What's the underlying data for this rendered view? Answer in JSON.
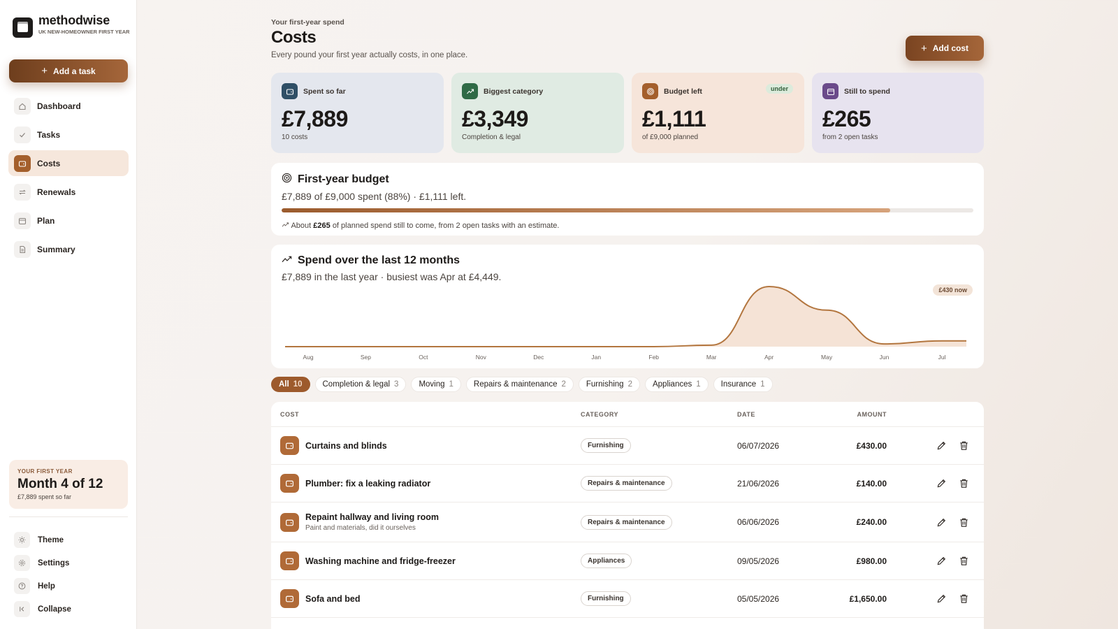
{
  "brand": {
    "name": "methodwise",
    "subtitle": "UK NEW-HOMEOWNER FIRST YEAR"
  },
  "sidebar": {
    "add_task_label": "Add a task",
    "items": [
      {
        "label": "Dashboard",
        "icon": "home-icon"
      },
      {
        "label": "Tasks",
        "icon": "check-icon"
      },
      {
        "label": "Costs",
        "icon": "wallet-icon",
        "active": true
      },
      {
        "label": "Renewals",
        "icon": "repeat-icon"
      },
      {
        "label": "Plan",
        "icon": "calendar-icon"
      },
      {
        "label": "Summary",
        "icon": "document-icon"
      }
    ],
    "year_card": {
      "label": "YOUR FIRST YEAR",
      "title": "Month 4 of 12",
      "subtitle": "£7,889 spent so far"
    },
    "footer": [
      {
        "label": "Theme",
        "icon": "sun-icon"
      },
      {
        "label": "Settings",
        "icon": "gear-icon"
      },
      {
        "label": "Help",
        "icon": "help-icon"
      },
      {
        "label": "Collapse",
        "icon": "collapse-icon"
      }
    ]
  },
  "header": {
    "eyebrow": "Your first-year spend",
    "title": "Costs",
    "description": "Every pound your first year actually costs, in one place.",
    "add_cost_label": "Add cost"
  },
  "stats": [
    {
      "label": "Spent so far",
      "value": "£7,889",
      "sub": "10 costs",
      "color": "#2f4f66"
    },
    {
      "label": "Biggest category",
      "value": "£3,349",
      "sub": "Completion & legal",
      "color": "#2f6a46"
    },
    {
      "label": "Budget left",
      "value": "£1,111",
      "sub": "of £9,000 planned",
      "color": "#a45f2c",
      "badge": "under"
    },
    {
      "label": "Still to spend",
      "value": "£265",
      "sub": "from 2 open tasks",
      "color": "#6a4a8a"
    }
  ],
  "budget": {
    "title": "First-year budget",
    "summary": "£7,889 of £9,000 spent (88%) · £1,111 left.",
    "progress_percent": 88,
    "note_prefix": "About",
    "note_amount": "£265",
    "note_suffix": "of planned spend still to come, from 2 open tasks with an estimate."
  },
  "spend": {
    "title": "Spend over the last 12 months",
    "summary": "£7,889 in the last year · busiest was Apr at £4,449.",
    "now_badge": "£430 now"
  },
  "chart_data": {
    "type": "area",
    "categories": [
      "Aug",
      "Sep",
      "Oct",
      "Nov",
      "Dec",
      "Jan",
      "Feb",
      "Mar",
      "Apr",
      "May",
      "Jun",
      "Jul"
    ],
    "values": [
      0,
      0,
      0,
      0,
      0,
      0,
      0,
      110,
      4449,
      2700,
      200,
      430
    ],
    "grid": false
  },
  "filters": [
    {
      "label": "All",
      "count": "10",
      "active": true
    },
    {
      "label": "Completion & legal",
      "count": "3"
    },
    {
      "label": "Moving",
      "count": "1"
    },
    {
      "label": "Repairs & maintenance",
      "count": "2"
    },
    {
      "label": "Furnishing",
      "count": "2"
    },
    {
      "label": "Appliances",
      "count": "1"
    },
    {
      "label": "Insurance",
      "count": "1"
    }
  ],
  "table": {
    "headers": {
      "cost": "COST",
      "category": "CATEGORY",
      "date": "DATE",
      "amount": "AMOUNT"
    },
    "rows": [
      {
        "name": "Curtains and blinds",
        "note": "",
        "category": "Furnishing",
        "date": "06/07/2026",
        "amount": "£430.00"
      },
      {
        "name": "Plumber: fix a leaking radiator",
        "note": "",
        "category": "Repairs & maintenance",
        "date": "21/06/2026",
        "amount": "£140.00"
      },
      {
        "name": "Repaint hallway and living room",
        "note": "Paint and materials, did it ourselves",
        "category": "Repairs & maintenance",
        "date": "06/06/2026",
        "amount": "£240.00"
      },
      {
        "name": "Washing machine and fridge-freezer",
        "note": "",
        "category": "Appliances",
        "date": "09/05/2026",
        "amount": "£980.00"
      },
      {
        "name": "Sofa and bed",
        "note": "",
        "category": "Furnishing",
        "date": "05/05/2026",
        "amount": "£1,650.00"
      }
    ]
  }
}
